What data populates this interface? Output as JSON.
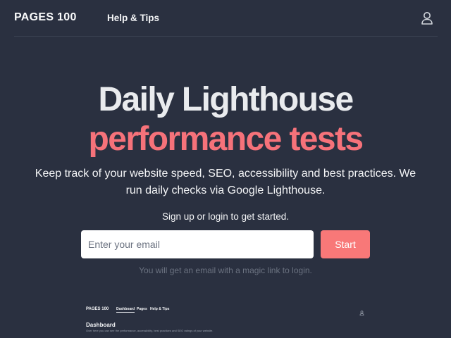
{
  "header": {
    "brand": "PAGES 100",
    "nav_help": "Help & Tips",
    "user_icon": "user-icon"
  },
  "hero": {
    "title_line1": "Daily Lighthouse",
    "title_line2": "performance tests",
    "description": "Keep track of your website speed, SEO, accessibility and best practices. We run daily checks via Google Lighthouse.",
    "signup_hint": "Sign up or login to get started.",
    "email_placeholder": "Enter your email",
    "email_value": "",
    "start_label": "Start",
    "magic_note": "You will get an email with a magic link to login."
  },
  "preview": {
    "brand": "PAGES 100",
    "nav": [
      "Dashboard",
      "Pages",
      "Help & Tips"
    ],
    "active_nav": "Dashboard",
    "title": "Dashboard",
    "subtitle": "Over here you can see the performance, accessibility, best practices and SEO ratings of your website."
  },
  "colors": {
    "background": "#2a3040",
    "accent": "#f6727a",
    "button": "#f87878",
    "muted_text": "#6b7280"
  }
}
